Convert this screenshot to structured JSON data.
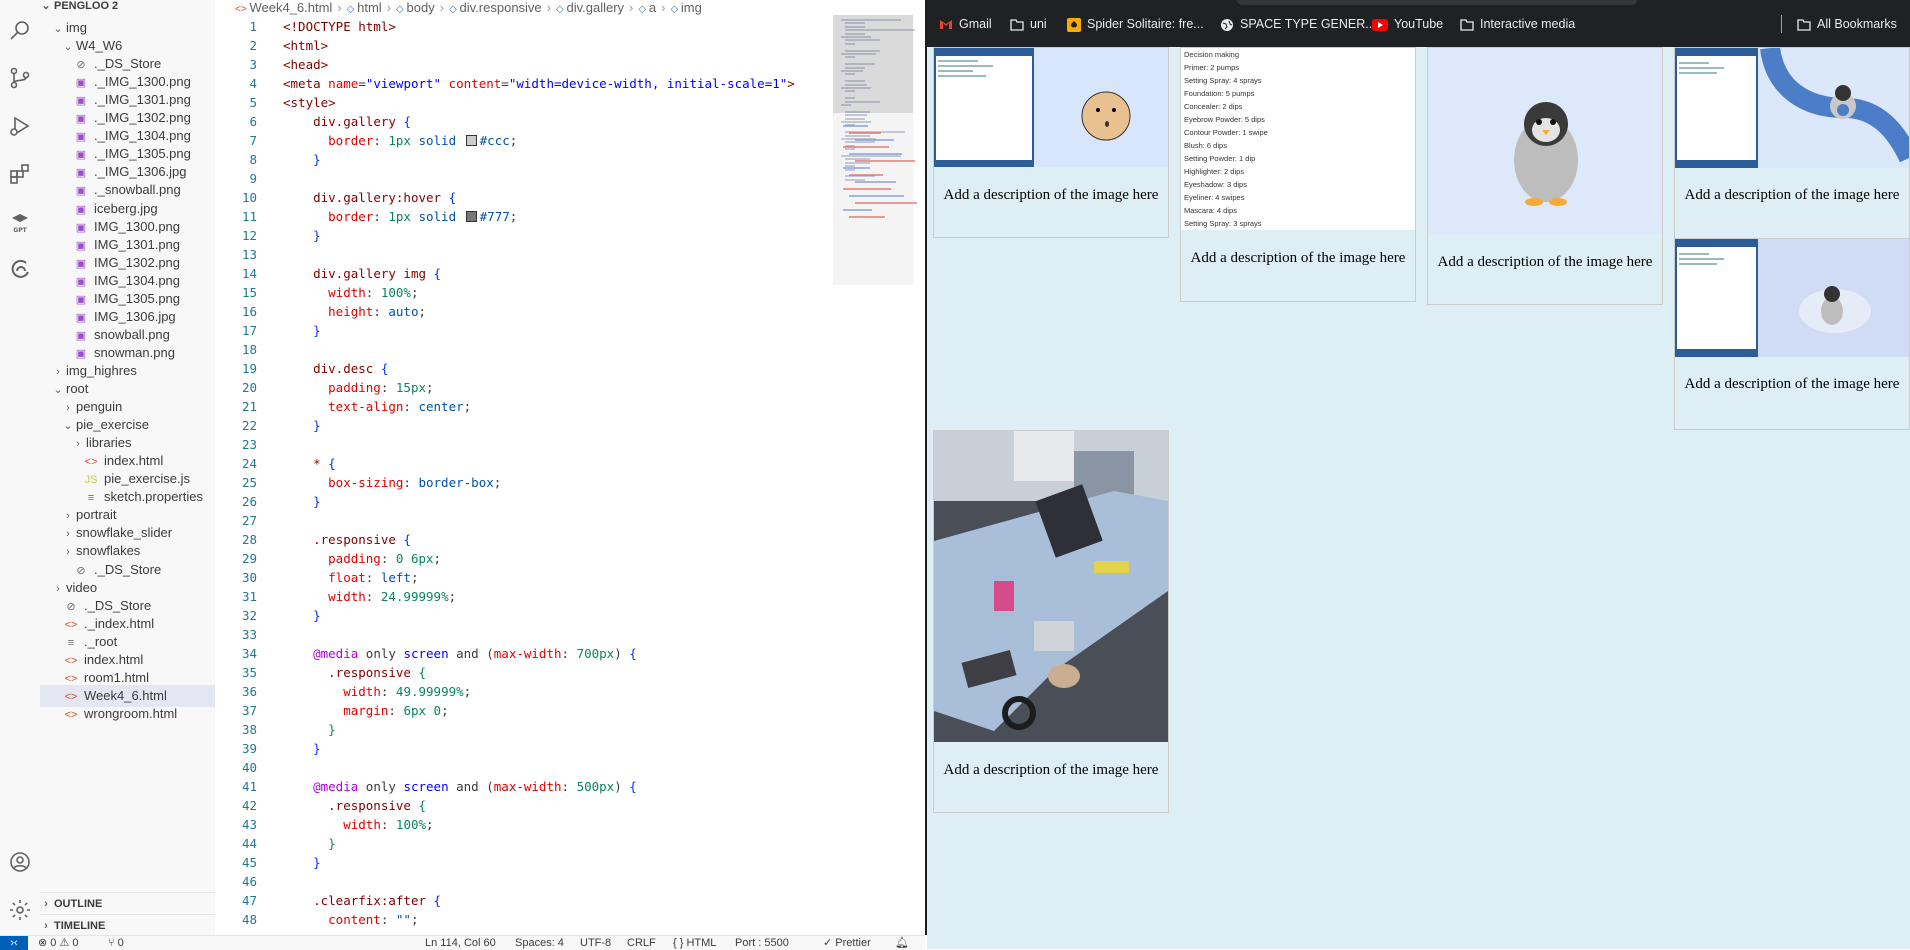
{
  "explorer": {
    "root_label": "PENGLOO 2",
    "rows": [
      {
        "label": "img",
        "kind": "folder-open",
        "indent": 1
      },
      {
        "label": "W4_W6",
        "kind": "folder-open",
        "indent": 2
      },
      {
        "label": "._DS_Store",
        "kind": "hidden",
        "indent": 2
      },
      {
        "label": "._IMG_1300.png",
        "kind": "image",
        "indent": 2
      },
      {
        "label": "._IMG_1301.png",
        "kind": "image",
        "indent": 2
      },
      {
        "label": "._IMG_1302.png",
        "kind": "image",
        "indent": 2
      },
      {
        "label": "._IMG_1304.png",
        "kind": "image",
        "indent": 2
      },
      {
        "label": "._IMG_1305.png",
        "kind": "image",
        "indent": 2
      },
      {
        "label": "._IMG_1306.jpg",
        "kind": "image",
        "indent": 2
      },
      {
        "label": "._snowball.png",
        "kind": "image",
        "indent": 2
      },
      {
        "label": "iceberg.jpg",
        "kind": "image",
        "indent": 2
      },
      {
        "label": "IMG_1300.png",
        "kind": "image",
        "indent": 2
      },
      {
        "label": "IMG_1301.png",
        "kind": "image",
        "indent": 2
      },
      {
        "label": "IMG_1302.png",
        "kind": "image",
        "indent": 2
      },
      {
        "label": "IMG_1304.png",
        "kind": "image",
        "indent": 2
      },
      {
        "label": "IMG_1305.png",
        "kind": "image",
        "indent": 2
      },
      {
        "label": "IMG_1306.jpg",
        "kind": "image",
        "indent": 2
      },
      {
        "label": "snowball.png",
        "kind": "image",
        "indent": 2
      },
      {
        "label": "snowman.png",
        "kind": "image",
        "indent": 2
      },
      {
        "label": "img_highres",
        "kind": "folder",
        "indent": 1
      },
      {
        "label": "root",
        "kind": "folder-open",
        "indent": 1
      },
      {
        "label": "penguin",
        "kind": "folder",
        "indent": 2
      },
      {
        "label": "pie_exercise",
        "kind": "folder-open",
        "indent": 2
      },
      {
        "label": "libraries",
        "kind": "folder",
        "indent": 3
      },
      {
        "label": "index.html",
        "kind": "html",
        "indent": 3
      },
      {
        "label": "pie_exercise.js",
        "kind": "js",
        "indent": 3
      },
      {
        "label": "sketch.properties",
        "kind": "text",
        "indent": 3
      },
      {
        "label": "portrait",
        "kind": "folder",
        "indent": 2
      },
      {
        "label": "snowflake_slider",
        "kind": "folder",
        "indent": 2
      },
      {
        "label": "snowflakes",
        "kind": "folder",
        "indent": 2
      },
      {
        "label": "._DS_Store",
        "kind": "hidden",
        "indent": 2
      },
      {
        "label": "video",
        "kind": "folder",
        "indent": 1
      },
      {
        "label": "._DS_Store",
        "kind": "hidden",
        "indent": 1
      },
      {
        "label": "._index.html",
        "kind": "html",
        "indent": 1
      },
      {
        "label": "._root",
        "kind": "text",
        "indent": 1
      },
      {
        "label": "index.html",
        "kind": "html",
        "indent": 1
      },
      {
        "label": "room1.html",
        "kind": "html",
        "indent": 1
      },
      {
        "label": "Week4_6.html",
        "kind": "html",
        "indent": 1,
        "selected": true
      },
      {
        "label": "wrongroom.html",
        "kind": "html",
        "indent": 1
      }
    ],
    "outline_label": "OUTLINE",
    "timeline_label": "TIMELINE"
  },
  "breadcrumb": [
    "Week4_6.html",
    "html",
    "body",
    "div.responsive",
    "div.gallery",
    "a",
    "img"
  ],
  "code": {
    "l1": "<!DOCTYPE html>",
    "l2": "<html>",
    "l3": "<head>",
    "l4_tag": "<meta",
    "l4_attr1": "name",
    "l4_val1": "\"viewport\"",
    "l4_attr2": "content",
    "l4_val2": "\"width=device-width, initial-scale=1\"",
    "l4_end": ">",
    "l5": "<style>",
    "l6": "div.gallery",
    "l7_prop": "border",
    "l7_num": "1px",
    "l7_kw": "solid",
    "l7_color": "#ccc",
    "l10": "div.gallery:hover",
    "l11_prop": "border",
    "l11_num": "1px",
    "l11_kw": "solid",
    "l11_color": "#777",
    "l14": "div.gallery img",
    "l15_prop": "width",
    "l15_val": "100%",
    "l16_prop": "height",
    "l16_val": "auto",
    "l19": "div.desc",
    "l20_prop": "padding",
    "l20_val": "15px",
    "l21_prop": "text-align",
    "l21_val": "center",
    "l24": "*",
    "l25_prop": "box-sizing",
    "l25_val": "border-box",
    "l28": ".responsive",
    "l29_prop": "padding",
    "l29_val": "0 6px",
    "l30_prop": "float",
    "l30_val": "left",
    "l31_prop": "width",
    "l31_val": "24.99999%",
    "l34_at": "@media",
    "l34_mid": "only",
    "l34_screen": "screen",
    "l34_and": "and",
    "l34_feat": "max-width",
    "l34_num": "700px",
    "l35": ".responsive",
    "l36_prop": "width",
    "l36_val": "49.99999%",
    "l37_prop": "margin",
    "l37_val": "6px 0",
    "l41_at": "@media",
    "l41_mid": "only",
    "l41_screen": "screen",
    "l41_and": "and",
    "l41_feat": "max-width",
    "l41_num": "500px",
    "l42": ".responsive",
    "l43_prop": "width",
    "l43_val": "100%",
    "l47": ".clearfix:after",
    "l48_prop": "content",
    "l48_val": "\"\""
  },
  "statusbar": {
    "problems": "⊗ 0 ⚠ 0",
    "ports": "⑂ 0",
    "position": "Ln 114, Col 60",
    "spaces": "Spaces: 4",
    "encoding": "UTF-8",
    "eol": "CRLF",
    "language": "{ } HTML",
    "port": "Port : 5500",
    "prettier": "✓ Prettier"
  },
  "bookmarks": {
    "gmail": "Gmail",
    "uni": "uni",
    "spider": "Spider Solitaire: fre...",
    "space": "SPACE TYPE GENER...",
    "youtube": "YouTube",
    "interactive": "Interactive media",
    "all": "All Bookmarks"
  },
  "gallery": {
    "desc": "Add a description of the image here",
    "list_items": [
      "Decision making",
      "Primer: 2 pumps",
      "Setting Spray: 4 sprays",
      "Foundation: 5 pumps",
      "Concealer: 2 dips",
      "Eyebrow Powder: 5 dips",
      "Contour Powder: 1 swipe",
      "Blush: 6 dips",
      "Setting Powder: 1 dip",
      "Highlighter: 2 dips",
      "Eyeshadow: 3 dips",
      "Eyeliner: 4 swipes",
      "Mascara: 4 dips",
      "Setting Spray: 3 sprays"
    ]
  },
  "colors": {
    "accent": "#005fb8",
    "browser_bg": "#ddeef5",
    "bookmark_bar": "#202124"
  }
}
